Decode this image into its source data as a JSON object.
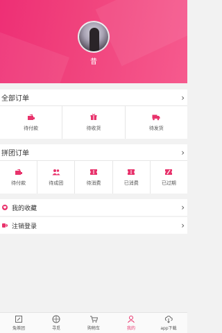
{
  "profile": {
    "nickname": "昔"
  },
  "orders": {
    "title": "全部订单",
    "items": [
      {
        "label": "待付款",
        "icon": "wallet-icon"
      },
      {
        "label": "待收货",
        "icon": "gift-box-icon"
      },
      {
        "label": "待发货",
        "icon": "truck-icon"
      }
    ]
  },
  "group_orders": {
    "title": "拼团订单",
    "items": [
      {
        "label": "待付款",
        "icon": "wallet-icon"
      },
      {
        "label": "待成团",
        "icon": "group-icon"
      },
      {
        "label": "待消费",
        "icon": "ticket-icon"
      },
      {
        "label": "已消费",
        "icon": "ticket-icon"
      },
      {
        "label": "已过期",
        "icon": "expired-ticket-icon"
      }
    ]
  },
  "links": {
    "favorites": "我的收藏",
    "logout": "注销登录"
  },
  "tabbar": {
    "items": [
      {
        "label": "兔茶团",
        "icon": "home-icon"
      },
      {
        "label": "寻觅",
        "icon": "compass-icon"
      },
      {
        "label": "购物车",
        "icon": "cart-icon"
      },
      {
        "label": "我的",
        "icon": "user-icon",
        "active": true
      },
      {
        "label": "app下载",
        "icon": "cloud-download-icon"
      }
    ]
  },
  "colors": {
    "accent": "#e8336c",
    "header_start": "#ee2f75",
    "header_end": "#f65a8e"
  }
}
